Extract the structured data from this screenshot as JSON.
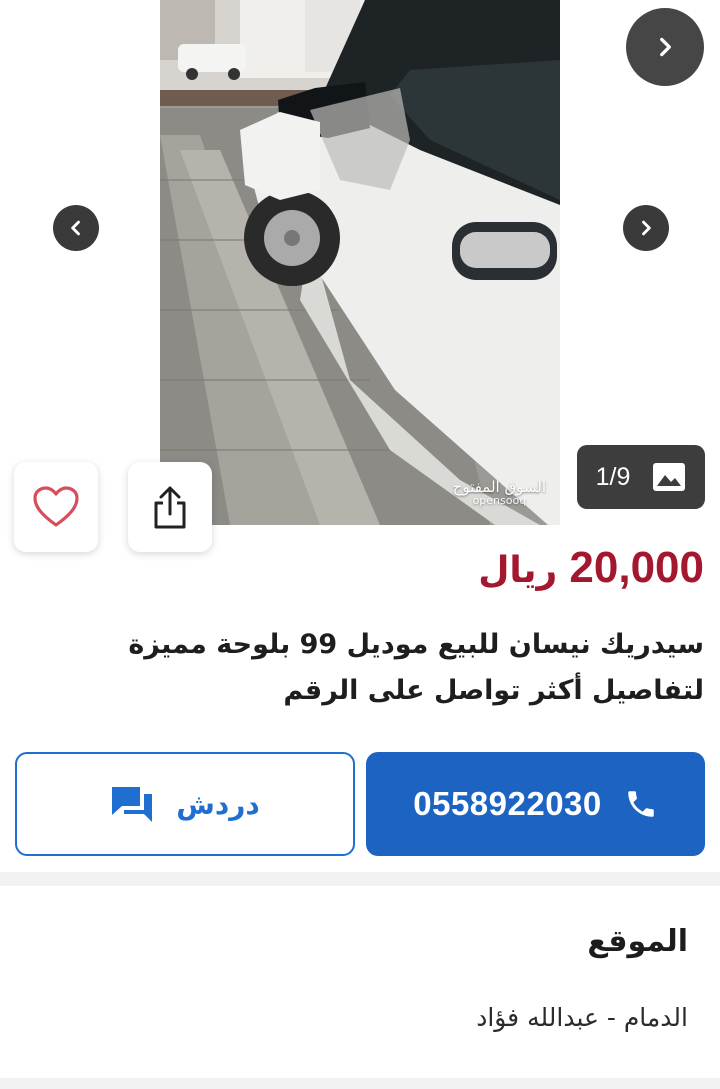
{
  "listing": {
    "price": "20,000",
    "currency": "ريال",
    "title": "سيدريك نيسان للبيع موديل 99 بلوحة مميزة لتفاصيل أكثر تواصل على الرقم",
    "image_counter": "1/9",
    "watermark_arabic": "السوق المفتوح",
    "watermark_latin": "opensooq"
  },
  "actions": {
    "call_label": "0558922030",
    "chat_label": "دردش"
  },
  "location": {
    "heading": "الموقع",
    "value": "الدمام - عبدالله فؤاد"
  },
  "icons": {
    "next": "chevron-right-icon",
    "prev": "chevron-left-icon",
    "gallery": "image-icon",
    "favorite": "heart-icon",
    "share": "share-icon",
    "phone": "phone-icon",
    "chat": "chat-icon"
  },
  "colors": {
    "price": "#a4182f",
    "primary": "#1c63c2",
    "chat_border": "#1f6fd1"
  }
}
